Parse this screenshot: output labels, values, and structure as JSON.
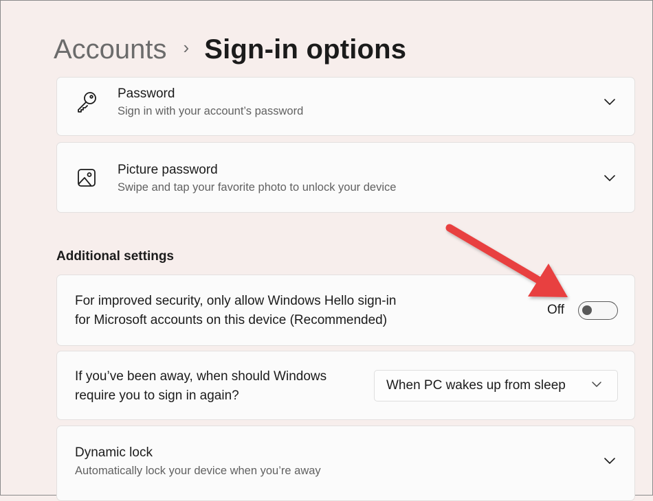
{
  "header": {
    "breadcrumb_parent": "Accounts",
    "breadcrumb_separator": "›",
    "page_title": "Sign-in options"
  },
  "sign_in_methods": [
    {
      "title": "Password",
      "description": "Sign in with your account’s password",
      "icon": "key-icon"
    },
    {
      "title": "Picture password",
      "description": "Swipe and tap your favorite photo to unlock your device",
      "icon": "picture-icon"
    }
  ],
  "additional_settings": {
    "heading": "Additional settings",
    "windows_hello_only": {
      "line1": "For improved security, only allow Windows Hello sign-in",
      "line2": "for Microsoft accounts on this device (Recommended)",
      "toggle_label": "Off",
      "toggle_on": false
    },
    "require_sign_in": {
      "line1": "If you’ve been away, when should Windows",
      "line2": "require you to sign in again?",
      "selected_option": "When PC wakes up from sleep"
    },
    "dynamic_lock": {
      "title": "Dynamic lock",
      "description": "Automatically lock your device when you’re away"
    }
  },
  "colors": {
    "background": "#f7eeec",
    "card": "#fbfbfb",
    "annotation_arrow": "#e8403f"
  }
}
